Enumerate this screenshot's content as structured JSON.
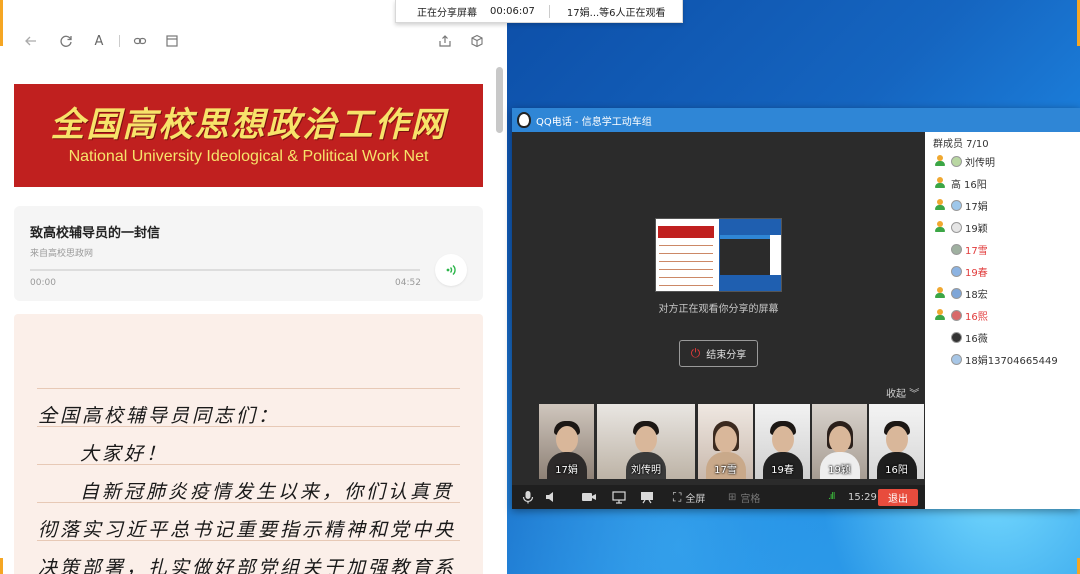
{
  "share_bar": {
    "status": "正在分享屏幕",
    "duration": "00:06:07",
    "viewers": "17娟...等6人正在观看"
  },
  "browser": {
    "toolbar_icons": [
      "back-arrow-icon",
      "refresh-icon",
      "font-size-icon",
      "link-icon",
      "layout-icon",
      "share-icon",
      "cube-icon"
    ],
    "font_button_label": "A",
    "banner": {
      "title_cn": "全国高校思想政治工作网",
      "title_en": "National University Ideological & Political Work Net",
      "color": "#c0201f",
      "text_color": "#f7e36a"
    },
    "audio": {
      "title": "致高校辅导员的一封信",
      "source": "来自高校思政网",
      "current_time": "00:00",
      "duration": "04:52",
      "progress": 0,
      "play_icon": "audio-wave-icon",
      "play_color": "#2cb54a"
    },
    "letter_lines": [
      "全国高校辅导员同志们：",
      "大家好！",
      "自新冠肺炎疫情发生以来，你们认真贯",
      "彻落实习近平总书记重要指示精神和党中央",
      "决策部署，扎实做好部党组关于加强教育系"
    ]
  },
  "qq_call": {
    "title": "QQ电话 - 信息学工动车组",
    "title_color": "#2f86d6",
    "preview_caption": "对方正在观看你分享的屏幕",
    "end_share_label": "结束分享",
    "collapse_label": "收起",
    "video_participants": [
      {
        "name": "17娟"
      },
      {
        "name": "刘传明"
      },
      {
        "name": "17雪"
      },
      {
        "name": "19春"
      },
      {
        "name": "19颖"
      },
      {
        "name": "16阳"
      }
    ],
    "controls": {
      "fullscreen_label": "全屏",
      "grid_label": "宫格",
      "time": "15:29",
      "exit_label": "退出",
      "exit_color": "#e84c3d"
    },
    "members": {
      "header": "群成员 7/10",
      "list": [
        {
          "name": "刘传明",
          "prefix": "",
          "in_call": true,
          "highlight": false
        },
        {
          "name": "16阳",
          "prefix": "高",
          "in_call": true,
          "highlight": false
        },
        {
          "name": "17娟",
          "prefix": "",
          "in_call": true,
          "highlight": false
        },
        {
          "name": "19颖",
          "prefix": "",
          "in_call": true,
          "highlight": false
        },
        {
          "name": "17雪",
          "prefix": "",
          "in_call": false,
          "highlight": true
        },
        {
          "name": "19春",
          "prefix": "",
          "in_call": false,
          "highlight": true
        },
        {
          "name": "18宏",
          "prefix": "",
          "in_call": true,
          "highlight": false
        },
        {
          "name": "16熙",
          "prefix": "",
          "in_call": true,
          "highlight": true
        },
        {
          "name": "16薇",
          "prefix": "",
          "in_call": false,
          "highlight": false
        },
        {
          "name": "18娟13704665449",
          "prefix": "",
          "in_call": false,
          "highlight": false
        }
      ],
      "highlight_color": "#e13b3b"
    }
  }
}
